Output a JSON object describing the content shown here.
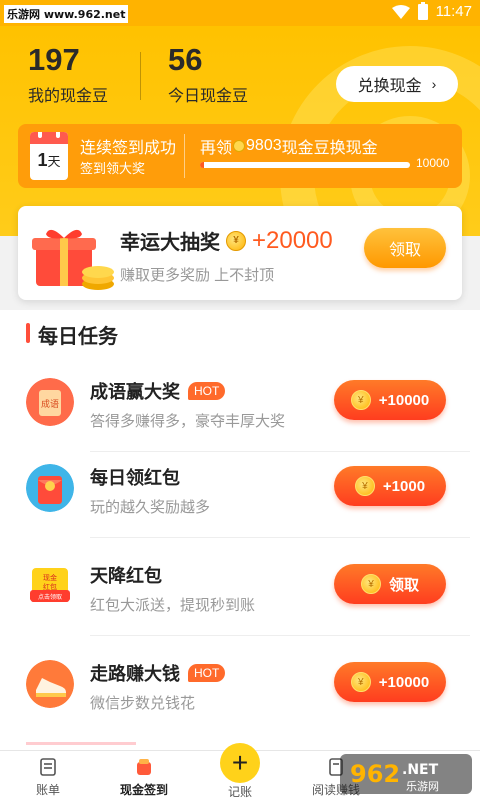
{
  "status_bar": {
    "watermark": "乐游网 www.962.net",
    "time": "11:47"
  },
  "header": {
    "my_beans_value": "197",
    "my_beans_label": "我的现金豆",
    "today_beans_value": "56",
    "today_beans_label": "今日现金豆",
    "exchange_button": "兑换现金",
    "signin": {
      "day_count": "1",
      "day_unit": "天",
      "title": "连续签到成功",
      "subtitle": "签到领大奖",
      "progress_prefix": "再领",
      "progress_remaining": "9803",
      "progress_suffix": "现金豆换现金",
      "progress_max": "10000",
      "progress_fraction": 0.02
    }
  },
  "lottery": {
    "title": "幸运大抽奖",
    "amount": "+20000",
    "subtitle": "赚取更多奖励 上不封顶",
    "button": "领取"
  },
  "daily_tasks": {
    "title": "每日任务",
    "items": [
      {
        "name": "成语赢大奖",
        "hot": "HOT",
        "desc": "答得多赚得多，豪夺丰厚大奖",
        "button": "+10000",
        "icon": "idiom-icon"
      },
      {
        "name": "每日领红包",
        "hot": "",
        "desc": "玩的越久奖励越多",
        "button": "+1000",
        "icon": "red-envelope-icon"
      },
      {
        "name": "天降红包",
        "hot": "",
        "desc": "红包大派送，提现秒到账",
        "button": "领取",
        "icon": "falling-red-envelope-icon"
      },
      {
        "name": "走路赚大钱",
        "hot": "HOT",
        "desc": "微信步数兑钱花",
        "button": "+10000",
        "icon": "shoe-icon"
      }
    ]
  },
  "bottom_nav": {
    "items": [
      "账单",
      "现金签到",
      "记账",
      "阅读赚钱"
    ],
    "active": "现金签到"
  },
  "colors": {
    "brand_yellow": "#ffc200",
    "accent_orange": "#ff9d0a",
    "accent_red": "#ff3d1f"
  }
}
